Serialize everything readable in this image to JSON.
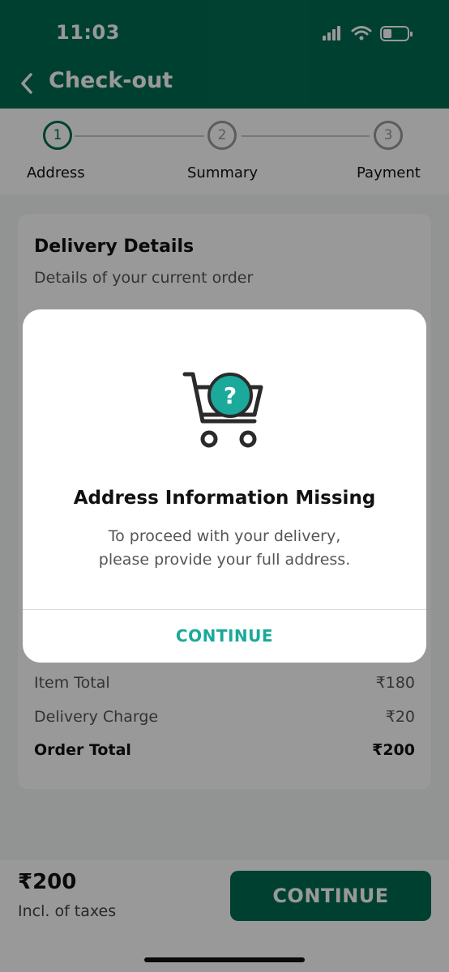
{
  "status_bar": {
    "time": "11:03"
  },
  "header": {
    "title": "Check-out"
  },
  "stepper": {
    "steps": [
      {
        "number": "1",
        "label": "Address"
      },
      {
        "number": "2",
        "label": "Summary"
      },
      {
        "number": "3",
        "label": "Payment"
      }
    ]
  },
  "card": {
    "title": "Delivery Details",
    "subtitle": "Details of your current order",
    "summary": [
      {
        "label": "Item Total",
        "value": "₹180"
      },
      {
        "label": "Delivery Charge",
        "value": "₹20"
      },
      {
        "label": "Order Total",
        "value": "₹200"
      }
    ]
  },
  "bottom_bar": {
    "total": "₹200",
    "note": "Incl. of taxes",
    "button_label": "CONTINUE"
  },
  "modal": {
    "title": "Address Information Missing",
    "message_line1": "To proceed with your delivery,",
    "message_line2": "please provide your full address.",
    "button_label": "CONTINUE",
    "icon": "cart-question-icon",
    "accent_color": "#1aa99a"
  },
  "colors": {
    "brand": "#006c52",
    "accent": "#1aa99a"
  }
}
